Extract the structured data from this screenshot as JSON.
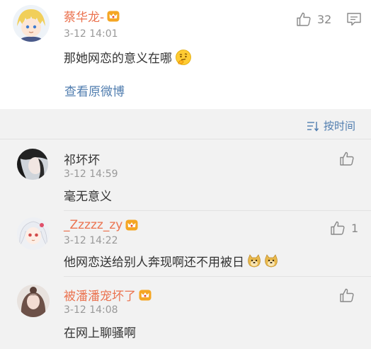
{
  "main_comment": {
    "username": "蔡华龙-",
    "time": "3-12 14:01",
    "text": "那她网恋的意义在哪",
    "like_count": "32",
    "view_original": "查看原微博"
  },
  "sort": {
    "label": "按时间"
  },
  "replies": [
    {
      "username": "祁坏坏",
      "time": "3-12 14:59",
      "text": "毫无意义",
      "like_count": ""
    },
    {
      "username": "_Zzzzz_zy",
      "time": "3-12 14:22",
      "text": "他网恋送给别人奔现啊还不用被日",
      "like_count": "1"
    },
    {
      "username": "被潘潘宠坏了",
      "time": "3-12 14:08",
      "text": "在网上聊骚啊",
      "like_count": ""
    }
  ],
  "colors": {
    "vip_name": "#eb7350",
    "link": "#507daf",
    "secondary": "#999999",
    "section_bg": "#f2f2f2"
  },
  "icons": [
    "thumbs-up-icon",
    "comment-icon",
    "sort-icon",
    "vip-crown-badge",
    "thinking-emoji",
    "doge-emoji"
  ]
}
